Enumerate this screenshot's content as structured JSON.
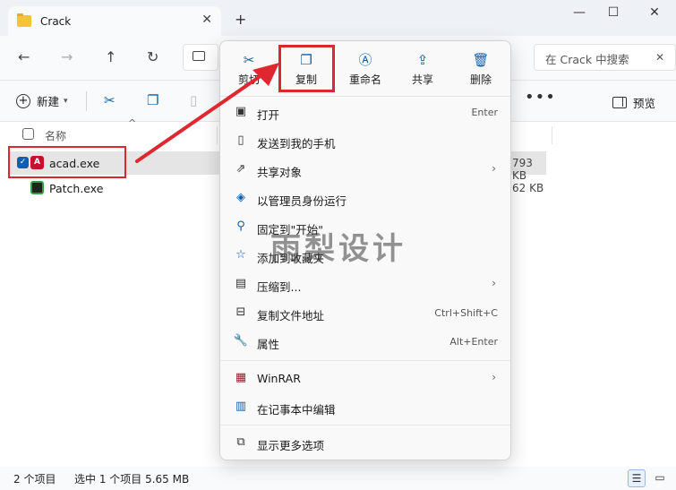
{
  "window": {
    "tab_title": "Crack",
    "tab_close": "✕",
    "new_tab": "+",
    "minimize": "—",
    "maximize": "☐",
    "close": "✕"
  },
  "nav": {
    "back": "←",
    "forward": "→",
    "up": "↑",
    "refresh": "↻",
    "search_placeholder": "在 Crack 中搜索",
    "search_clear": "✕"
  },
  "toolbar": {
    "new_label": "新建",
    "more": "•••",
    "preview_label": "预览"
  },
  "columns": {
    "name": "名称"
  },
  "files": [
    {
      "name": "acad.exe",
      "size": "793 KB",
      "selected": true,
      "icon": "autocad-app-icon"
    },
    {
      "name": "Patch.exe",
      "size": "62 KB",
      "selected": false,
      "icon": "patch-app-icon"
    }
  ],
  "status": {
    "item_count": "2 个项目",
    "selection": "选中 1 个项目  5.65 MB"
  },
  "context_menu": {
    "quick_actions": [
      {
        "label": "剪切",
        "icon": "scissors-icon"
      },
      {
        "label": "复制",
        "icon": "copy-icon"
      },
      {
        "label": "重命名",
        "icon": "rename-icon"
      },
      {
        "label": "共享",
        "icon": "share-icon"
      },
      {
        "label": "删除",
        "icon": "trash-icon"
      }
    ],
    "items": [
      {
        "label": "打开",
        "shortcut": "Enter"
      },
      {
        "label": "发送到我的手机"
      },
      {
        "label": "共享对象",
        "submenu": true
      },
      {
        "label": "以管理员身份运行"
      },
      {
        "label": "固定到\"开始\""
      },
      {
        "label": "添加到收藏夹"
      },
      {
        "label": "压缩到...",
        "submenu": true
      },
      {
        "label": "复制文件地址",
        "shortcut": "Ctrl+Shift+C"
      },
      {
        "label": "属性",
        "shortcut": "Alt+Enter"
      },
      {
        "label": "WinRAR",
        "submenu": true
      },
      {
        "label": "在记事本中编辑"
      },
      {
        "label": "显示更多选项"
      }
    ]
  },
  "watermark": "雨梨设计",
  "colors": {
    "accent": "#0e5fae",
    "annotation_red": "#d9282f",
    "selection": "#e5e5e5"
  }
}
